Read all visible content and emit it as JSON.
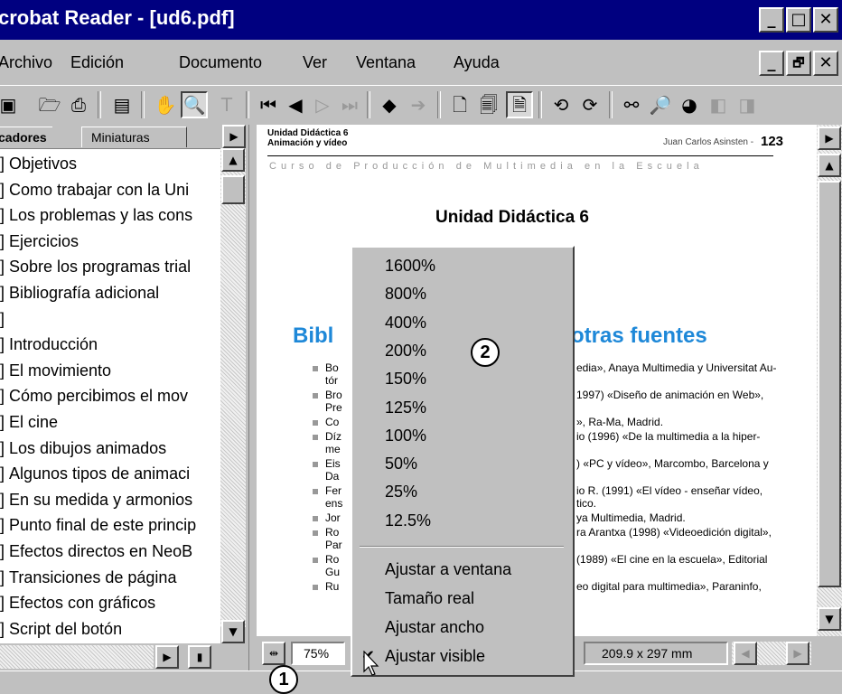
{
  "window": {
    "title": "crobat Reader - [ud6.pdf]",
    "controls": [
      "_",
      "□",
      "✕"
    ]
  },
  "menu": {
    "items": [
      {
        "label": "Archivo"
      },
      {
        "label": "Edición"
      },
      {
        "label": "Documento"
      },
      {
        "label": "Ver"
      },
      {
        "label": "Ventana"
      },
      {
        "label": "Ayuda"
      }
    ],
    "doc_controls": [
      "_",
      "🗗",
      "✕"
    ]
  },
  "toolbar": {
    "icons": [
      "open-icon",
      "print-icon",
      "page-layout-icon",
      "hand-tool-icon",
      "zoom-tool-icon",
      "text-select-icon",
      "first-page-icon",
      "prev-page-icon",
      "next-page-icon",
      "last-page-icon",
      "back-icon",
      "forward-icon",
      "single-page-icon",
      "continuous-icon",
      "facing-icon",
      "rotate-left-icon",
      "rotate-right-icon",
      "find-icon",
      "search-icon",
      "web-search-icon",
      "prev-result-icon",
      "next-result-icon"
    ]
  },
  "left_panel": {
    "tabs": [
      "cadores",
      "Miniaturas"
    ],
    "bookmarks": [
      "Objetivos",
      "Como trabajar con la Uni",
      "Los problemas y las cons",
      "Ejercicios",
      "Sobre los programas trial",
      "Bibliografía adicional",
      "",
      "Introducción",
      "El movimiento",
      "Cómo percibimos el mov",
      "El cine",
      "Los dibujos animados",
      "Algunos tipos de animaci",
      "En su medida y armonios",
      "Punto final de este princip",
      "Efectos directos en NeoB",
      "Transiciones de página",
      "Efectos con gráficos",
      "Script del botón"
    ]
  },
  "document": {
    "header_left_1": "Unidad Didáctica 6",
    "header_left_2": "Animación y vídeo",
    "header_author": "Juan Carlos Asinsten -",
    "header_page": "123",
    "course_line": "C u r s o   d e   P r o d u c c i ó n   d e   M u l t i m e d i a   e n   l a   E s c u e l a",
    "unit_title": "Unidad Didáctica 6",
    "section_left": "Bibl",
    "section_right": "otras fuentes",
    "biblio": [
      {
        "left": "Bo",
        "right": "edia», Anaya Multimedia y Universitat Au-"
      },
      {
        "left": "tór",
        "right": ""
      },
      {
        "left": "Bro",
        "right": "1997) «Diseño de animación en Web»,"
      },
      {
        "left": "Pre",
        "right": ""
      },
      {
        "left": "Co",
        "right": "», Ra-Ma, Madrid."
      },
      {
        "left": "Díz",
        "right": "io (1996) «De la multimedia a la hiper-"
      },
      {
        "left": "me",
        "right": ""
      },
      {
        "left": "Eis",
        "right": ") «PC y vídeo», Marcombo, Barcelona y"
      },
      {
        "left": "Da",
        "right": ""
      },
      {
        "left": "Fer",
        "right": "io R. (1991) «El vídeo - enseñar vídeo,"
      },
      {
        "left": "ens",
        "right": "tico."
      },
      {
        "left": "Jor",
        "right": "ya Multimedia, Madrid."
      },
      {
        "left": "Ro",
        "right": "ra Arantxa (1998) «Videoedición digital»,"
      },
      {
        "left": "Par",
        "right": ""
      },
      {
        "left": "Ro",
        "right": "(1989) «El cine en la escuela», Editorial"
      },
      {
        "left": "Gu",
        "right": ""
      },
      {
        "left": "Ru",
        "right": "eo digital para multimedia», Paraninfo,"
      }
    ]
  },
  "status": {
    "zoom_value": "75%",
    "page_size": "209.9 x 297  mm"
  },
  "zoom_menu": {
    "percent_options": [
      "1600%",
      "800%",
      "400%",
      "200%",
      "150%",
      "125%",
      "100%",
      "50%",
      "25%",
      "12.5%"
    ],
    "fit_options": [
      "Ajustar a ventana",
      "Tamaño real",
      "Ajustar ancho",
      "Ajustar visible"
    ],
    "checked": "Ajustar visible"
  },
  "callouts": {
    "c1": "1",
    "c2": "2"
  }
}
